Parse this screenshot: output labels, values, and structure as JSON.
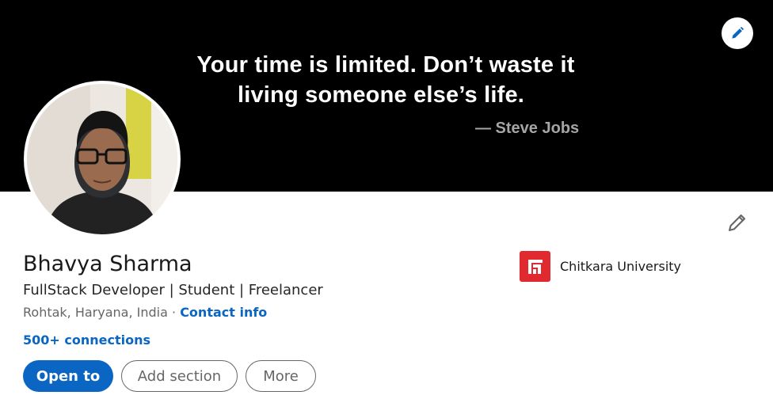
{
  "banner": {
    "quote_line1": "Your time is limited. Don’t waste it",
    "quote_line2": "living someone else’s life.",
    "quote_author": "— Steve Jobs",
    "background_color": "#000000",
    "edit_icon": "pencil-icon"
  },
  "profile": {
    "name": "Bhavya Sharma",
    "headline": "FullStack Developer | Student | Freelancer",
    "location": "Rohtak, Haryana, India",
    "separator": " · ",
    "contact_info": "Contact info",
    "connections": "500+ connections",
    "edit_icon": "pencil-icon"
  },
  "actions": {
    "open_to": "Open to",
    "add_section": "Add section",
    "more": "More"
  },
  "education": {
    "name": "Chitkara University",
    "logo_color": "#e02a2f"
  },
  "colors": {
    "link": "#0a66c2",
    "primary_button": "#0a66c2"
  }
}
